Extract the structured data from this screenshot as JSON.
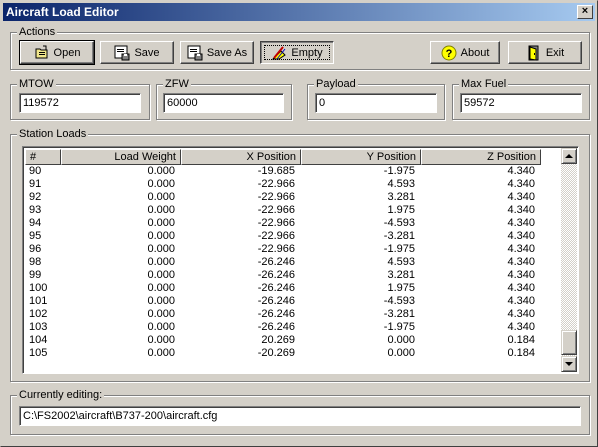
{
  "window": {
    "title": "Aircraft Load Editor",
    "close_label": "×"
  },
  "actions": {
    "group_label": "Actions",
    "open_label": "Open",
    "save_label": "Save",
    "save_as_label": "Save As",
    "empty_label": "Empty",
    "about_label": "About",
    "exit_label": "Exit"
  },
  "fields": {
    "mtow": {
      "label": "MTOW",
      "value": "119572"
    },
    "zfw": {
      "label": "ZFW",
      "value": "60000"
    },
    "payload": {
      "label": "Payload",
      "value": "0"
    },
    "max_fuel": {
      "label": "Max Fuel",
      "value": "59572"
    }
  },
  "station_loads": {
    "group_label": "Station Loads",
    "columns": [
      "#",
      "Load Weight",
      "X Position",
      "Y Position",
      "Z Position"
    ],
    "rows": [
      [
        "90",
        "0.000",
        "-19.685",
        "-1.975",
        "4.340"
      ],
      [
        "91",
        "0.000",
        "-22.966",
        "4.593",
        "4.340"
      ],
      [
        "92",
        "0.000",
        "-22.966",
        "3.281",
        "4.340"
      ],
      [
        "93",
        "0.000",
        "-22.966",
        "1.975",
        "4.340"
      ],
      [
        "94",
        "0.000",
        "-22.966",
        "-4.593",
        "4.340"
      ],
      [
        "95",
        "0.000",
        "-22.966",
        "-3.281",
        "4.340"
      ],
      [
        "96",
        "0.000",
        "-22.966",
        "-1.975",
        "4.340"
      ],
      [
        "98",
        "0.000",
        "-26.246",
        "4.593",
        "4.340"
      ],
      [
        "99",
        "0.000",
        "-26.246",
        "3.281",
        "4.340"
      ],
      [
        "100",
        "0.000",
        "-26.246",
        "1.975",
        "4.340"
      ],
      [
        "101",
        "0.000",
        "-26.246",
        "-4.593",
        "4.340"
      ],
      [
        "102",
        "0.000",
        "-26.246",
        "-3.281",
        "4.340"
      ],
      [
        "103",
        "0.000",
        "-26.246",
        "-1.975",
        "4.340"
      ],
      [
        "104",
        "0.000",
        "20.269",
        "0.000",
        "0.184"
      ],
      [
        "105",
        "0.000",
        "-20.269",
        "0.000",
        "0.184"
      ]
    ]
  },
  "current": {
    "group_label": "Currently editing:",
    "path": "C:\\FS2002\\aircraft\\B737-200\\aircraft.cfg"
  },
  "colors": {
    "title_start": "#0a246a",
    "title_end": "#a6caf0",
    "face": "#d4d0c8"
  }
}
